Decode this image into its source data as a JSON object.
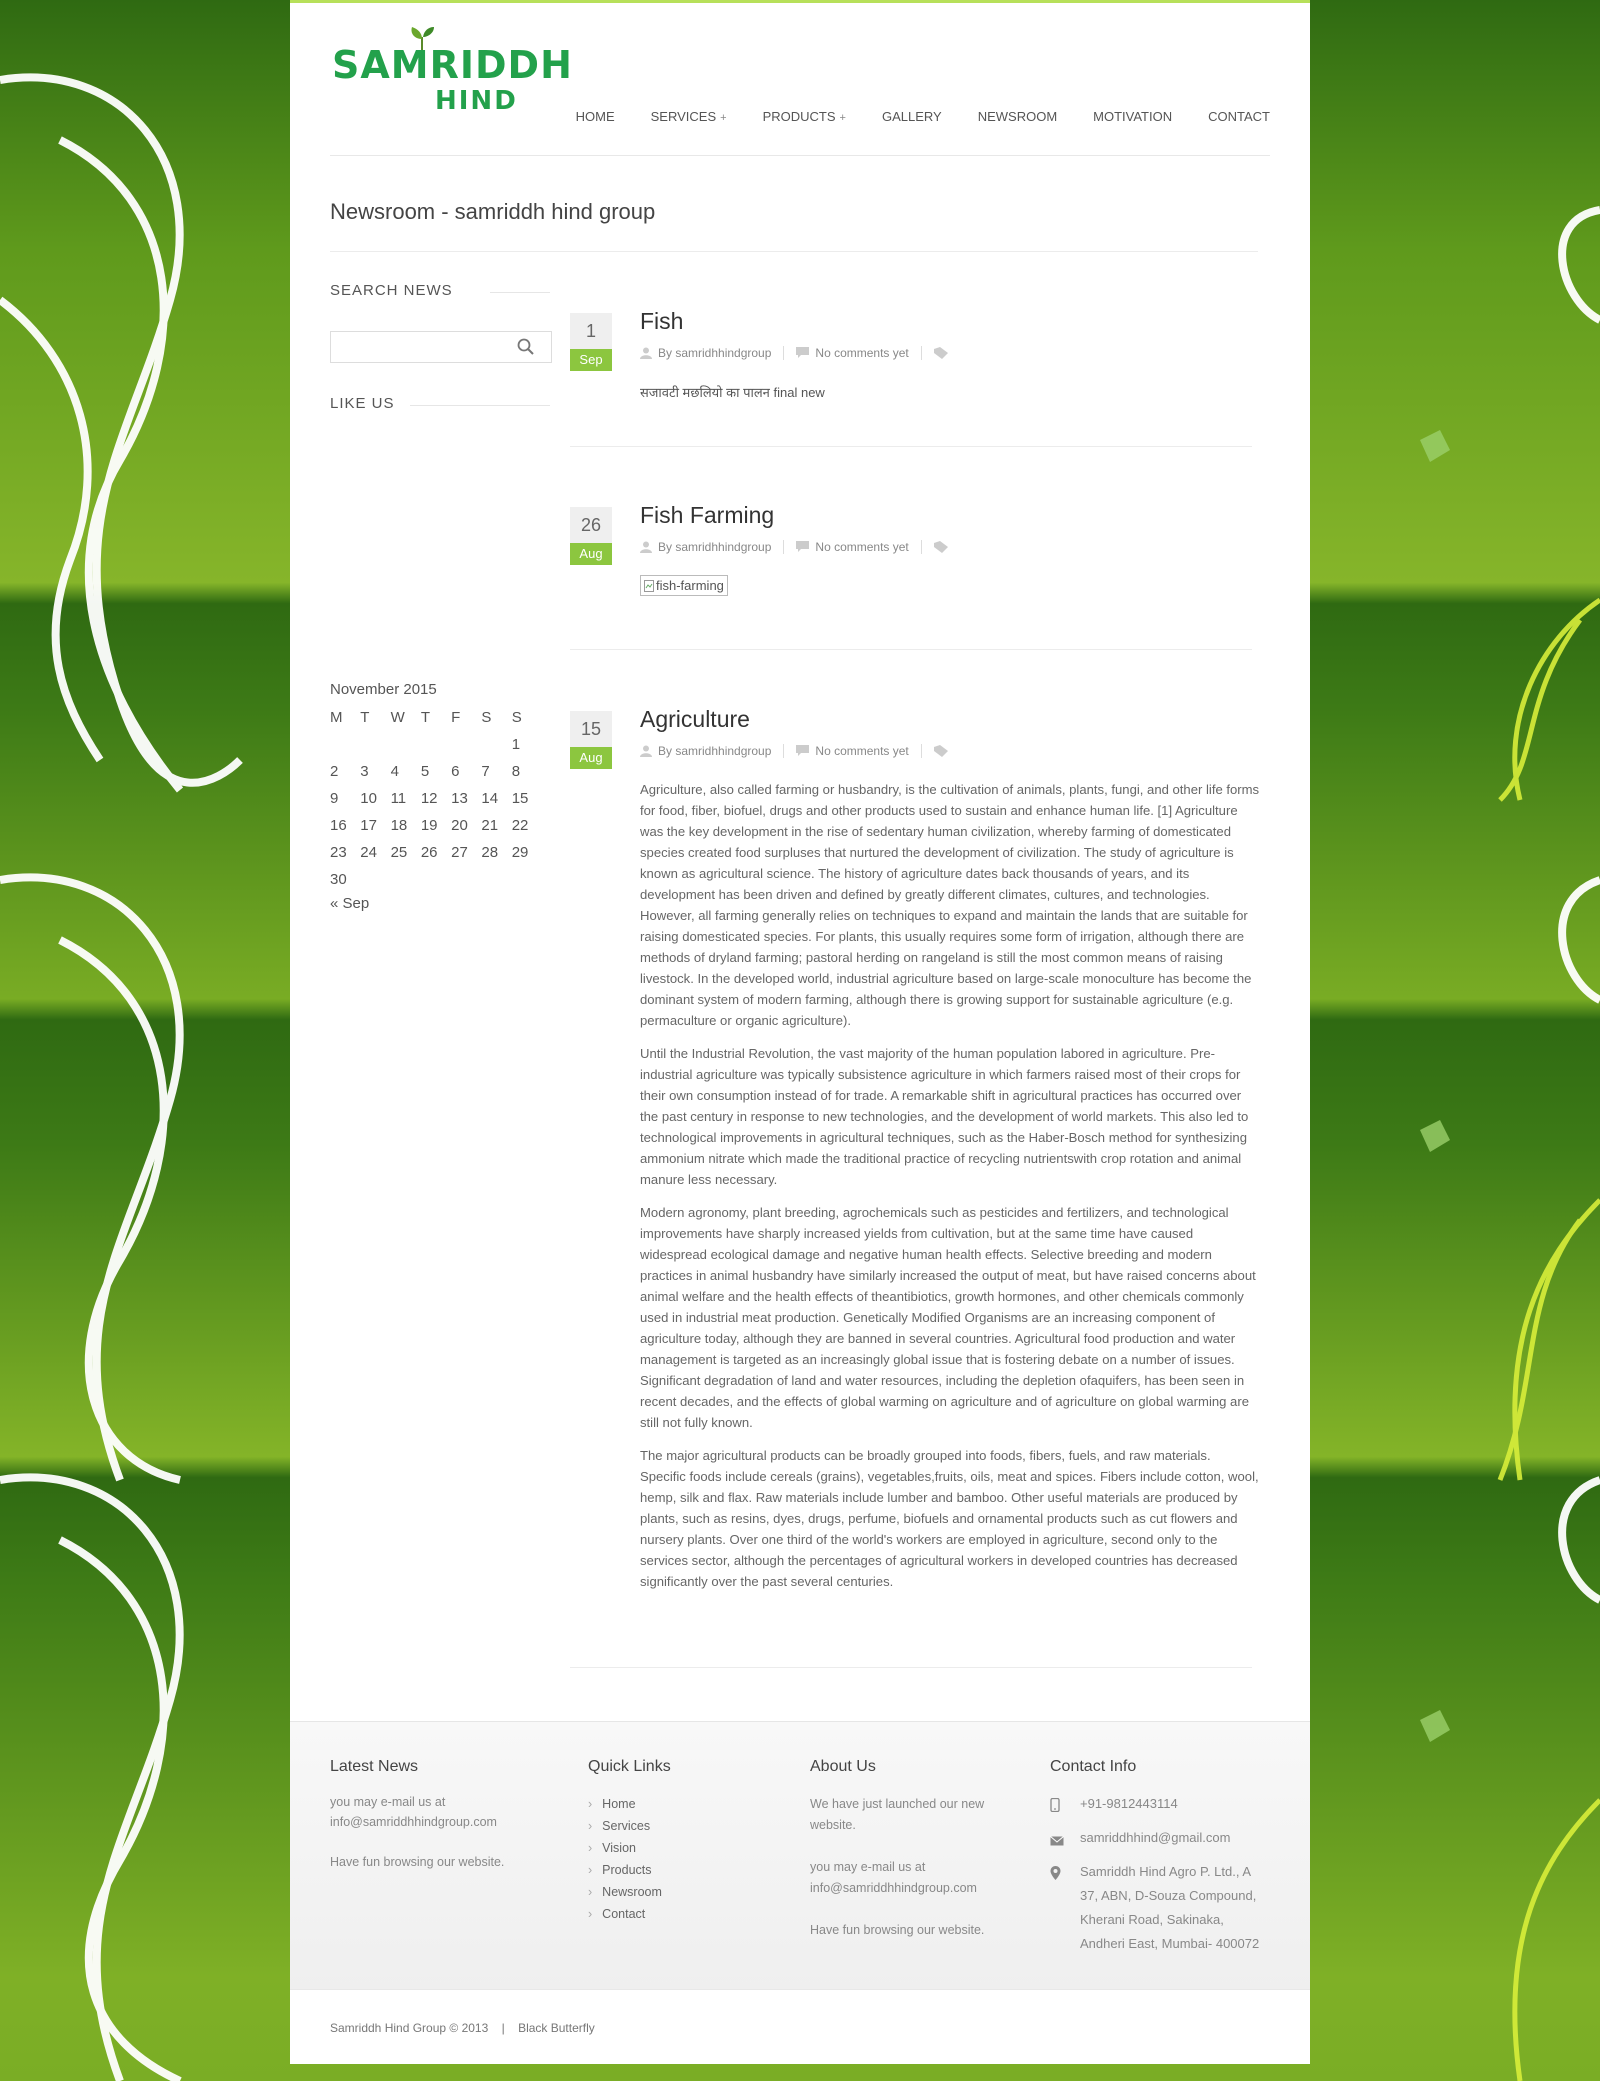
{
  "colors": {
    "accent_green": "#8cc63f",
    "logo_green": "#23a14b",
    "bg_green": "#4f8c19"
  },
  "logo": {
    "line1": "SAMRIDDH",
    "line2": "HIND"
  },
  "nav": {
    "items": [
      {
        "label": "HOME"
      },
      {
        "label": "SERVICES",
        "plus": "+"
      },
      {
        "label": "PRODUCTS",
        "plus": "+"
      },
      {
        "label": "GALLERY"
      },
      {
        "label": "NEWSROOM"
      },
      {
        "label": "MOTIVATION"
      },
      {
        "label": "CONTACT"
      }
    ]
  },
  "page_title": "Newsroom - samriddh hind group",
  "sidebar": {
    "search_title": "SEARCH NEWS",
    "search_placeholder": "",
    "like_title": "LIKE US",
    "calendar": {
      "caption": "November 2015",
      "weekdays": [
        "M",
        "T",
        "W",
        "T",
        "F",
        "S",
        "S"
      ],
      "weeks": [
        [
          "",
          "",
          "",
          "",
          "",
          "",
          "1"
        ],
        [
          "2",
          "3",
          "4",
          "5",
          "6",
          "7",
          "8"
        ],
        [
          "9",
          "10",
          "11",
          "12",
          "13",
          "14",
          "15"
        ],
        [
          "16",
          "17",
          "18",
          "19",
          "20",
          "21",
          "22"
        ],
        [
          "23",
          "24",
          "25",
          "26",
          "27",
          "28",
          "29"
        ],
        [
          "30",
          "",
          "",
          "",
          "",
          "",
          ""
        ]
      ],
      "prev": "« Sep"
    }
  },
  "posts": [
    {
      "day": "1",
      "month": "Sep",
      "title": "Fish",
      "author": "By samridhhindgroup",
      "comments": "No comments yet",
      "excerpt": "सजावटी मछलियो का पालन final new"
    },
    {
      "day": "26",
      "month": "Aug",
      "title": "Fish Farming",
      "author": "By samridhhindgroup",
      "comments": "No comments yet",
      "image_alt": "fish-farming"
    },
    {
      "day": "15",
      "month": "Aug",
      "title": "Agriculture",
      "author": "By samridhhindgroup",
      "comments": "No comments yet",
      "paragraphs": [
        "Agriculture, also called farming or husbandry, is the cultivation of animals, plants, fungi, and other life forms for food, fiber, biofuel, drugs and other products used to sustain and enhance human life. [1] Agriculture was the key development in the rise of sedentary human civilization, whereby farming of domesticated species created food surpluses that nurtured the development of civilization. The study of agriculture is known as agricultural science. The history of agriculture dates back thousands of years, and its development has been driven and defined by greatly different climates, cultures, and technologies. However, all farming generally relies on techniques to expand and maintain the lands that are suitable for raising domesticated species. For plants, this usually requires some form of irrigation, although there are methods of dryland farming; pastoral herding on rangeland is still the most common means of raising livestock. In the developed world, industrial agriculture based on large-scale monoculture has become the dominant system of modern farming, although there is growing support for sustainable agriculture (e.g. permaculture or organic agriculture).",
        "Until the Industrial Revolution, the vast majority of the human population labored in agriculture. Pre-industrial agriculture was typically subsistence agriculture in which farmers raised most of their crops for their own consumption instead of for trade. A remarkable shift in agricultural practices has occurred over the past century in response to new technologies, and the development of world markets. This also led to technological improvements in agricultural techniques, such as the Haber-Bosch method for synthesizing ammonium nitrate which made the traditional practice of recycling nutrientswith crop rotation and animal manure less necessary.",
        "Modern agronomy, plant breeding, agrochemicals such as pesticides and fertilizers, and technological improvements have sharply increased yields from cultivation, but at the same time have caused widespread ecological damage and negative human health effects. Selective breeding and modern practices in animal husbandry have similarly increased the output of meat, but have raised concerns about animal welfare and the health effects of theantibiotics, growth hormones, and other chemicals commonly used in industrial meat production. Genetically Modified Organisms are an increasing component of agriculture today, although they are banned in several countries. Agricultural food production and water management is targeted as an increasingly global issue that is fostering debate on a number of issues. Significant degradation of land and water resources, including the depletion ofaquifers, has been seen in recent decades, and the effects of global warming on agriculture and of agriculture on global warming are still not fully known.",
        "The major agricultural products can be broadly grouped into foods, fibers, fuels, and raw materials. Specific foods include cereals (grains), vegetables,fruits, oils, meat and spices. Fibers include cotton, wool, hemp, silk and flax. Raw materials include lumber and bamboo. Other useful materials are produced by plants, such as resins, dyes, drugs, perfume, biofuels and ornamental products such as cut flowers and nursery plants. Over one third of the world's workers are employed in agriculture, second only to the services sector, although the percentages of agricultural workers in developed countries has decreased significantly over the past several centuries."
      ]
    }
  ],
  "footer": {
    "latest": {
      "title": "Latest News",
      "line1": "you may e-mail us at",
      "line2": "info@samriddhhindgroup.com",
      "line3": "Have fun browsing our website."
    },
    "quick": {
      "title": "Quick Links",
      "links": [
        "Home",
        "Services",
        "Vision",
        "Products",
        "Newsroom",
        "Contact"
      ],
      "arrow": "›"
    },
    "about": {
      "title": "About Us",
      "line1": "We have just launched our new",
      "line2": "website.",
      "line3": "you may e-mail us at",
      "line4": "info@samriddhhindgroup.com",
      "line5": "Have fun browsing our website."
    },
    "contact": {
      "title": "Contact Info",
      "phone": "+91-9812443114",
      "email": "samriddhhind@gmail.com",
      "addr1": "Samriddh Hind Agro P. Ltd., A",
      "addr2": "37, ABN, D-Souza Compound,",
      "addr3": "Kherani Road, Sakinaka,",
      "addr4": "Andheri East, Mumbai- 400072"
    }
  },
  "bottom": {
    "copyright": "Samriddh Hind Group © 2013",
    "divider": "|",
    "credit": "Black Butterfly"
  },
  "icons": {
    "search": "search-icon",
    "user": "user-icon",
    "comment": "comment-icon",
    "tag": "tag-icon",
    "phone": "phone-icon",
    "mail": "mail-icon",
    "pin": "location-pin-icon"
  }
}
